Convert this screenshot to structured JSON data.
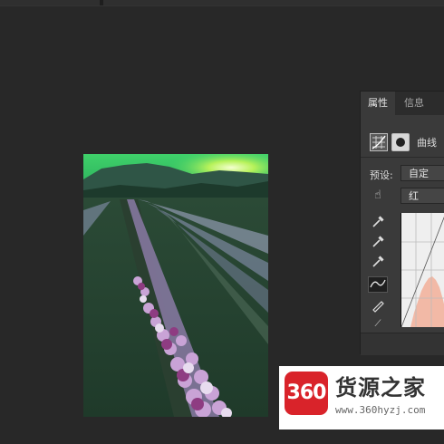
{
  "panel": {
    "tabs": [
      {
        "label": "属性",
        "active": true
      },
      {
        "label": "信息",
        "active": false
      }
    ],
    "adjustment_label": "曲线",
    "preset_label": "预设:",
    "preset_value": "自定",
    "channel_value": "红",
    "tools": [
      "eyedropper-black-icon",
      "eyedropper-gray-icon",
      "eyedropper-white-icon",
      "curve-point-icon",
      "pencil-icon",
      "smooth-curve-icon"
    ]
  },
  "watermark": {
    "logo_text": "360",
    "name": "货源之家",
    "url": "www.360hyzj.com"
  },
  "colors": {
    "app_background": "#282828",
    "panel_background": "#3a3a3a",
    "watermark_red": "#d9232a",
    "histogram_fill": "#f2b9a6"
  }
}
